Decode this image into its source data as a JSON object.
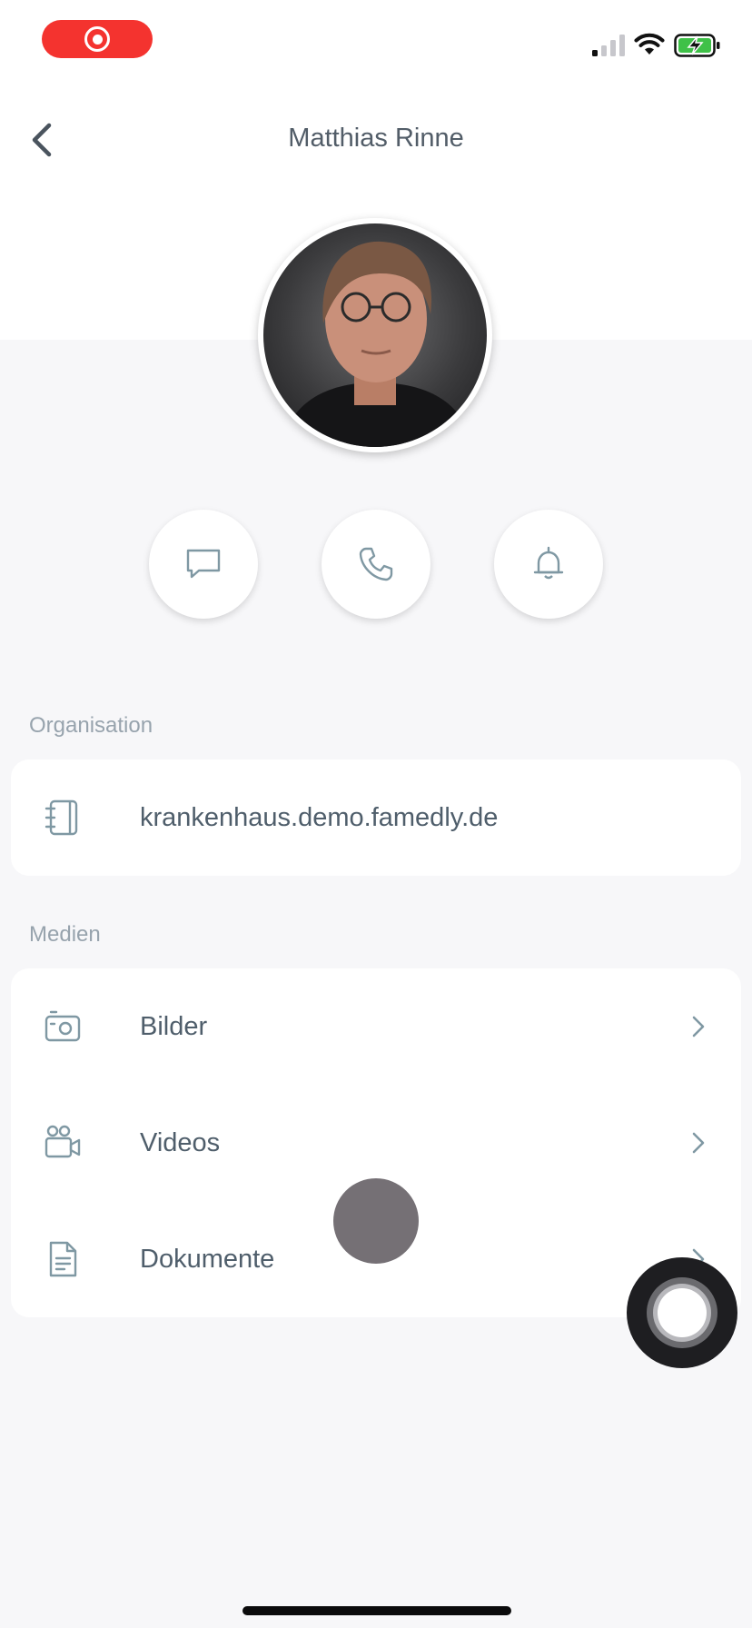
{
  "status_bar": {
    "recording_indicator": "screen-recording-icon",
    "signal_icon": "cellular-signal-icon",
    "wifi_icon": "wifi-icon",
    "battery_icon": "battery-charging-icon"
  },
  "header": {
    "title": "Matthias Rinne",
    "back_icon": "chevron-left-icon"
  },
  "profile": {
    "avatar_icon": "user-photo"
  },
  "actions": [
    {
      "name": "message",
      "icon": "chat-bubble-icon"
    },
    {
      "name": "call",
      "icon": "phone-icon"
    },
    {
      "name": "notifications",
      "icon": "bell-icon"
    }
  ],
  "organisation": {
    "label": "Organisation",
    "server": "krankenhaus.demo.famedly.de",
    "icon": "notebook-icon"
  },
  "media": {
    "label": "Medien",
    "items": [
      {
        "label": "Bilder",
        "icon": "camera-icon"
      },
      {
        "label": "Videos",
        "icon": "video-camera-icon"
      },
      {
        "label": "Dokumente",
        "icon": "document-icon"
      }
    ]
  },
  "colors": {
    "accent_icon": "#7f98a3",
    "recording": "#f4332f",
    "section_label": "#97a3ad",
    "text": "#4f5e6b"
  }
}
